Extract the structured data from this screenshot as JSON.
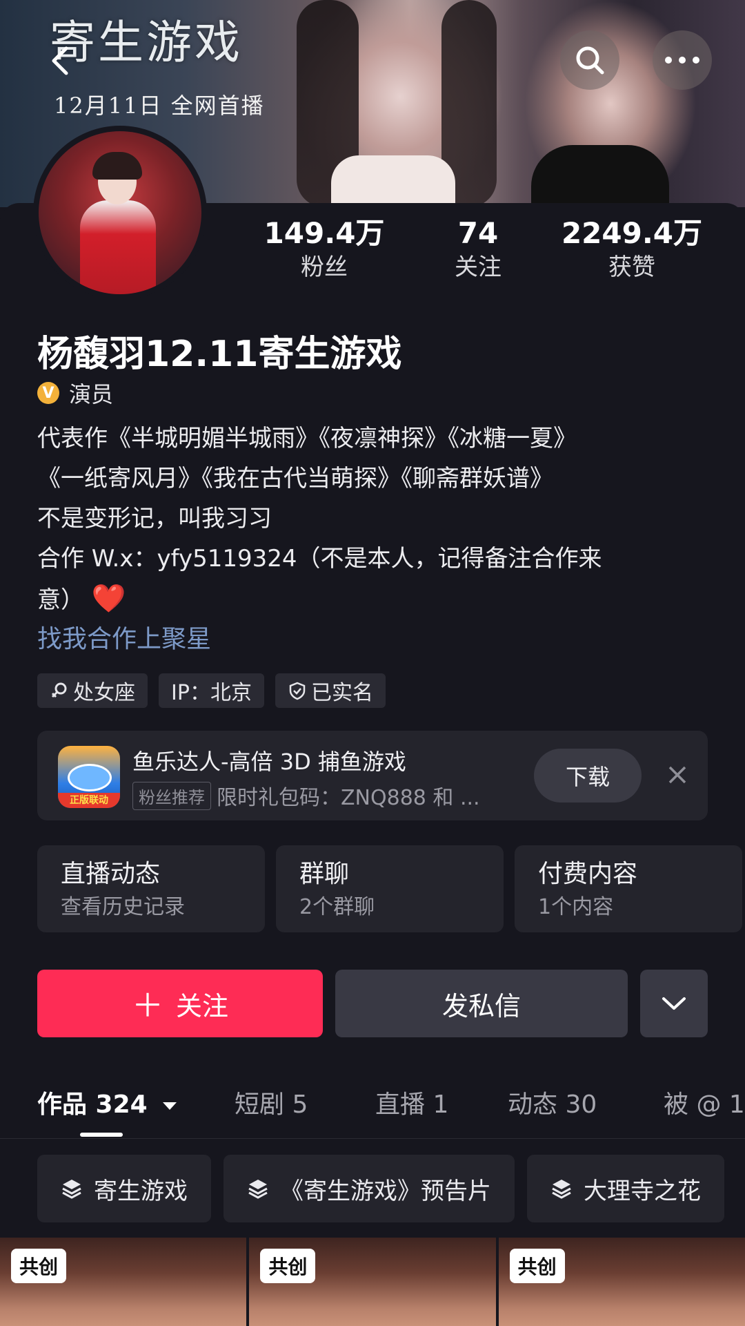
{
  "banner": {
    "poster_title": "寄生游戏",
    "poster_subtitle": "12月11日 全网首播"
  },
  "header": {
    "back_icon": "chevron-left-icon",
    "search_icon": "search-icon",
    "more_icon": "more-horizontal-icon"
  },
  "stats": [
    {
      "value": "149.4万",
      "label": "粉丝"
    },
    {
      "value": "74",
      "label": "关注"
    },
    {
      "value": "2249.4万",
      "label": "获赞"
    }
  ],
  "profile": {
    "name": "杨馥羽12.11寄生游戏",
    "verify_badge": "V",
    "role": "演员",
    "bio_lines": [
      "代表作《半城明媚半城雨》《夜凛神探》《冰糖一夏》",
      "《一纸寄风月》《我在古代当萌探》《聊斋群妖谱》",
      "不是变形记，叫我习习",
      "合作 W.x：yfy5119324（不是本人，记得备注合作来",
      "意）"
    ],
    "heart": "❤️",
    "biz_link": "找我合作上聚星",
    "tags": [
      "处女座",
      "IP：北京",
      "已实名"
    ]
  },
  "ad": {
    "title": "鱼乐达人-高倍 3D 捕鱼游戏",
    "badge": "粉丝推荐",
    "subtitle": "限时礼包码：ZNQ888 和 ...",
    "icon_badge": "正版联动",
    "download_label": "下载"
  },
  "cards": [
    {
      "title": "直播动态",
      "sub": "查看历史记录"
    },
    {
      "title": "群聊",
      "sub": "2个群聊"
    },
    {
      "title": "付费内容",
      "sub": "1个内容"
    }
  ],
  "actions": {
    "follow_label": "关注",
    "message_label": "发私信"
  },
  "tabs": [
    {
      "label": "作品 324"
    },
    {
      "label": "短剧 5"
    },
    {
      "label": "直播 1"
    },
    {
      "label": "动态 30"
    },
    {
      "label": "被 @ 1"
    }
  ],
  "collections": [
    "寄生游戏",
    "《寄生游戏》预告片",
    "大理寺之花"
  ],
  "thumbs": [
    {
      "label": "共创"
    },
    {
      "label": "共创"
    },
    {
      "label": "共创"
    }
  ],
  "colors": {
    "accent": "#fe2c55",
    "link": "#7d9ac8",
    "background": "#16161e"
  }
}
